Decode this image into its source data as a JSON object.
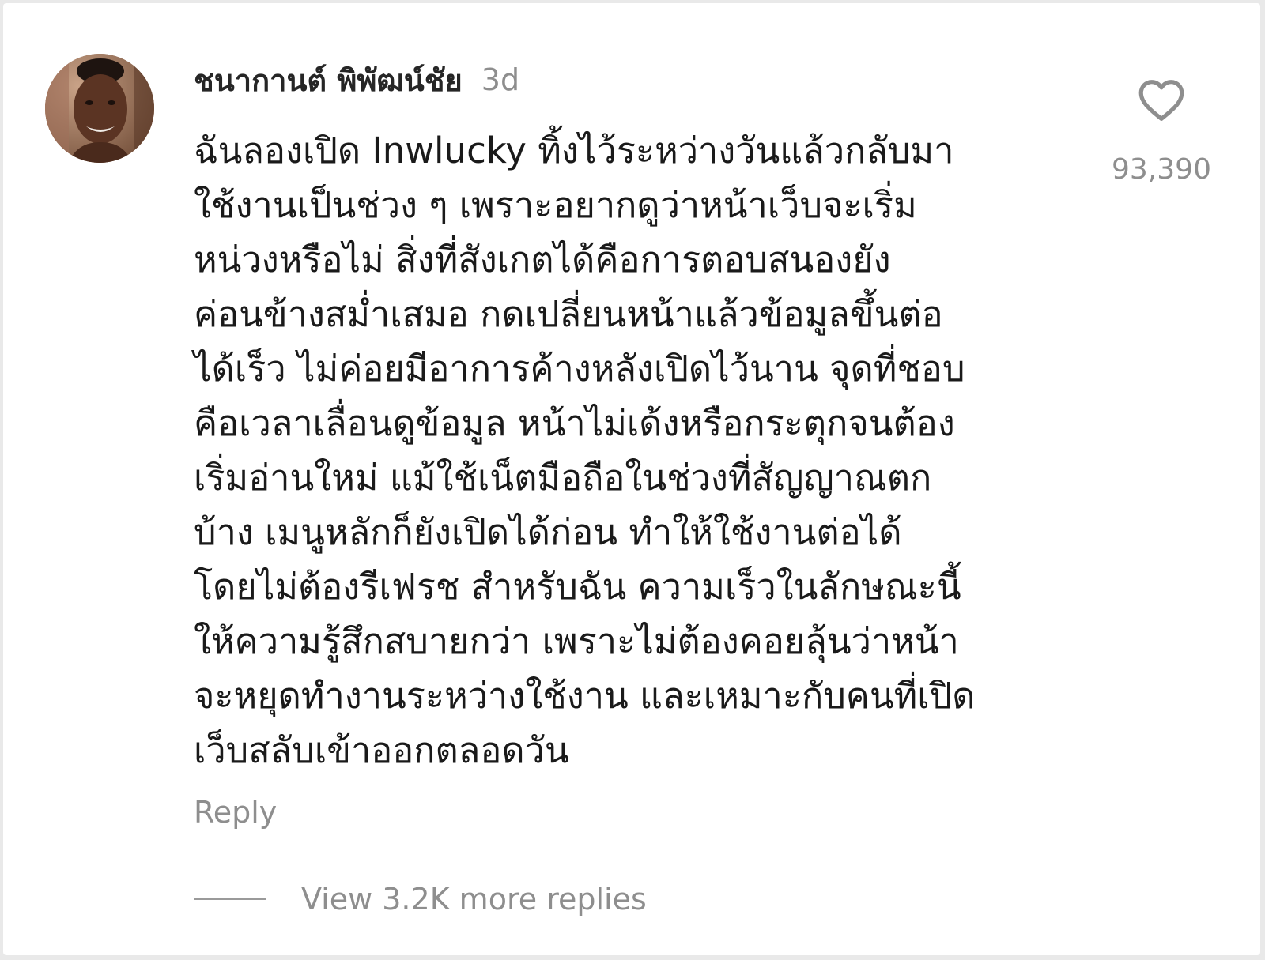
{
  "comment": {
    "author": "ชนากานต์ พิพัฒน์ชัย",
    "timestamp": "3d",
    "avatar": "avatar-photo",
    "lines": [
      "ฉันลองเปิด Inwlucky ทิ้งไว้ระหว่างวันแล้วกลับมา",
      "ใช้งานเป็นช่วง ๆ เพราะอยากดูว่าหน้าเว็บจะเริ่ม",
      "หน่วงหรือไม่ สิ่งที่สังเกตได้คือการตอบสนองยัง",
      "ค่อนข้างสม่ำเสมอ กดเปลี่ยนหน้าแล้วข้อมูลขึ้นต่อ",
      "ได้เร็ว ไม่ค่อยมีอาการค้างหลังเปิดไว้นาน จุดที่ชอบ",
      "คือเวลาเลื่อนดูข้อมูล หน้าไม่เด้งหรือกระตุกจนต้อง",
      "เริ่มอ่านใหม่ แม้ใช้เน็ตมือถือในช่วงที่สัญญาณตก",
      "บ้าง เมนูหลักก็ยังเปิดได้ก่อน ทำให้ใช้งานต่อได้",
      "โดยไม่ต้องรีเฟรช สำหรับฉัน ความเร็วในลักษณะนี้",
      "ให้ความรู้สึกสบายกว่า เพราะไม่ต้องคอยลุ้นว่าหน้า",
      "จะหยุดทำงานระหว่างใช้งาน และเหมาะกับคนที่เปิด",
      "เว็บสลับเข้าออกตลอดวัน"
    ],
    "reply_label": "Reply",
    "like_icon": "heart-outline-icon",
    "like_count": "93,390",
    "view_replies_label": "View 3.2K more replies"
  },
  "colors": {
    "text_primary": "#1a1a1a",
    "text_secondary": "#8e8e8e",
    "background": "#ffffff"
  }
}
